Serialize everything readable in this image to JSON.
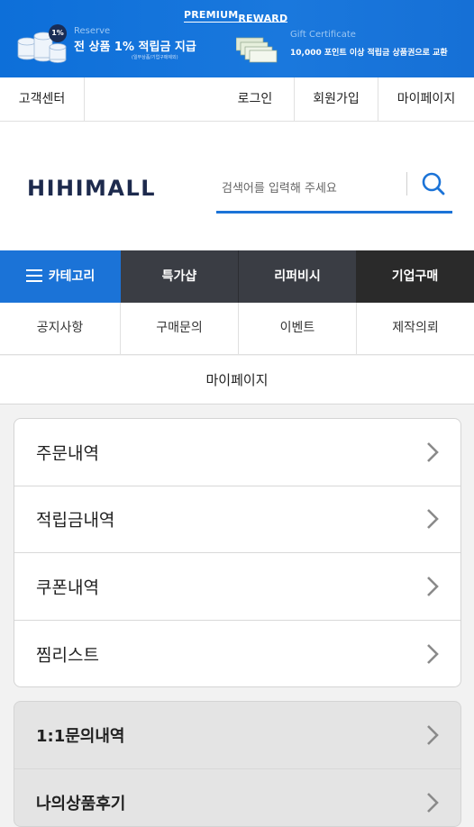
{
  "banner": {
    "reserve_badge": "1%",
    "reserve_eng": "Reserve",
    "reserve_main": "전 상품 1% 적립금 지급",
    "reserve_sub": "(일부상품/기업구매제외)",
    "premium_word": "PREMIUM",
    "reward_word": "REWARD",
    "gift_eng": "Gift Certificate",
    "gift_main": "10,000 포인트 이상 적립금 상품권으로 교환"
  },
  "toplinks": {
    "customer_center": "고객센터",
    "login": "로그인",
    "signup": "회원가입",
    "mypage": "마이페이지"
  },
  "header": {
    "logo": "HIHIMALL",
    "search_placeholder": "검색어를 입력해 주세요"
  },
  "main_nav": {
    "category": "카테고리",
    "special_shop": "특가샵",
    "refurbished": "리퍼비시",
    "corporate": "기업구매"
  },
  "sub_nav": {
    "notice": "공지사항",
    "purchase_inquiry": "구매문의",
    "event": "이벤트",
    "production_request": "제작의뢰"
  },
  "page_title": "마이페이지",
  "menu_primary": [
    {
      "label": "주문내역"
    },
    {
      "label": "적립금내역"
    },
    {
      "label": "쿠폰내역"
    },
    {
      "label": "찜리스트"
    }
  ],
  "menu_secondary": [
    {
      "label": "1:1문의내역"
    },
    {
      "label": "나의상품후기"
    }
  ],
  "colors": {
    "brand_blue": "#1b73d7",
    "nav_dark": "#3a3d44",
    "nav_black": "#2a2a2a"
  }
}
